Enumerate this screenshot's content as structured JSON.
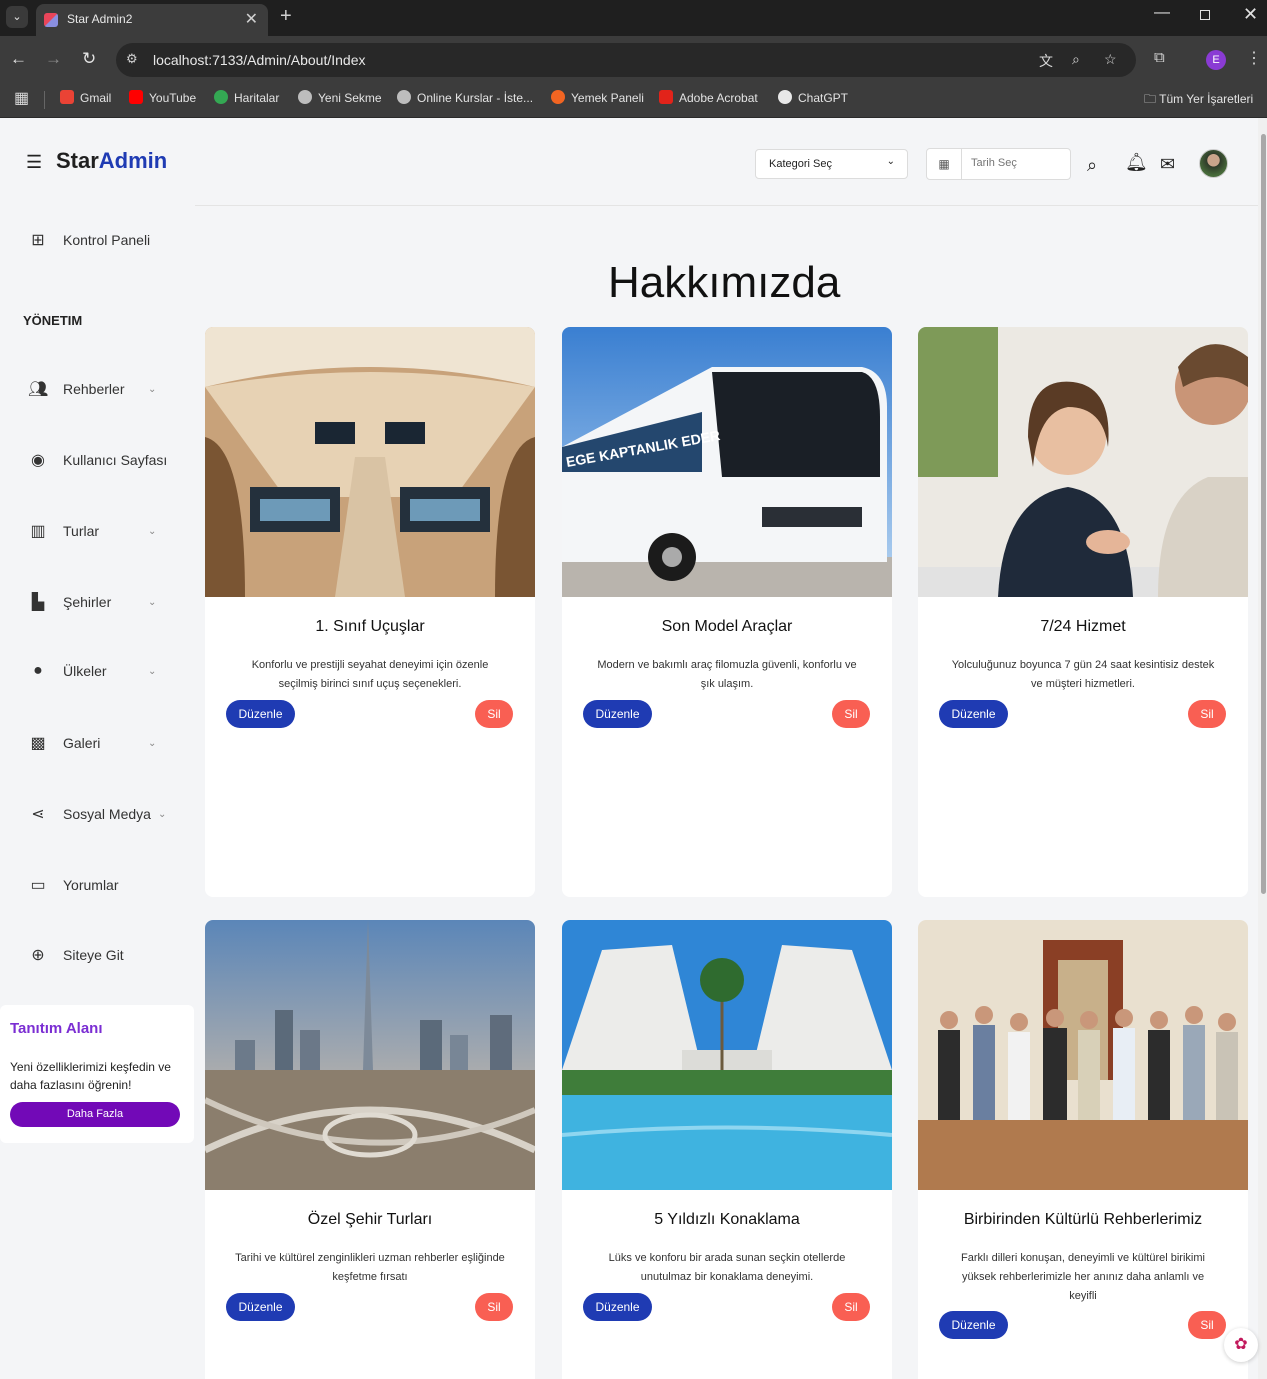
{
  "browser": {
    "tab_title": "Star Admin2",
    "url": "localhost:7133/Admin/About/Index",
    "profile_initial": "E",
    "bookmarks": [
      "Gmail",
      "YouTube",
      "Haritalar",
      "Yeni Sekme",
      "Online Kurslar - İste...",
      "Yemek Paneli",
      "Adobe Acrobat",
      "ChatGPT"
    ],
    "all_bookmarks": "Tüm Yer İşaretleri"
  },
  "brand": {
    "part1": "Star",
    "part2": "Admin"
  },
  "header": {
    "category_select": "Kategori Seç",
    "date_placeholder": "Tarih Seç"
  },
  "sidebar": {
    "dashboard": "Kontrol Paneli",
    "heading": "YÖNETIM",
    "items": [
      {
        "label": "Rehberler",
        "icon": "users-icon",
        "has_chevron": true
      },
      {
        "label": "Kullanıcı Sayfası",
        "icon": "user-circle-icon",
        "has_chevron": false
      },
      {
        "label": "Turlar",
        "icon": "map-icon",
        "has_chevron": true
      },
      {
        "label": "Şehirler",
        "icon": "city-icon",
        "has_chevron": true
      },
      {
        "label": "Ülkeler",
        "icon": "globe-icon",
        "has_chevron": true
      },
      {
        "label": "Galeri",
        "icon": "image-icon",
        "has_chevron": true
      },
      {
        "label": "Sosyal Medya",
        "icon": "share-icon",
        "has_chevron": true
      },
      {
        "label": "Yorumlar",
        "icon": "comment-icon",
        "has_chevron": false
      },
      {
        "label": "Siteye Git",
        "icon": "web-icon",
        "has_chevron": false
      }
    ],
    "promo": {
      "title": "Tanıtım Alanı",
      "text": "Yeni özelliklerimizi keşfedin ve daha fazlasını öğrenin!",
      "button": "Daha Fazla"
    }
  },
  "main": {
    "title": "Hakkımızda",
    "edit_label": "Düzenle",
    "delete_label": "Sil",
    "cards": [
      {
        "title": "1. Sınıf Uçuşlar",
        "text": "Konforlu ve prestijli seyahat deneyimi için özenle seçilmiş birinci sınıf uçuş seçenekleri."
      },
      {
        "title": "Son Model Araçlar",
        "text": "Modern ve bakımlı araç filomuzla güvenli, konforlu ve şık ulaşım."
      },
      {
        "title": "7/24 Hizmet",
        "text": "Yolculuğunuz boyunca 7 gün 24 saat kesintisiz destek ve müşteri hizmetleri."
      },
      {
        "title": "Özel Şehir Turları",
        "text": "Tarihi ve kültürel zenginlikleri uzman rehberler eşliğinde keşfetme fırsatı"
      },
      {
        "title": "5 Yıldızlı Konaklama",
        "text": "Lüks ve konforu bir arada sunan seçkin otellerde unutulmaz bir konaklama deneyimi."
      },
      {
        "title": "Birbirinden Kültürlü Rehberlerimiz",
        "text": "Farklı dilleri konuşan, deneyimli ve kültürel birikimi yüksek rehberlerimizle her anınız daha anlamlı ve keyifli"
      }
    ]
  },
  "colors": {
    "accent": "#1f3bb3",
    "danger": "#f95f53",
    "promo": "#7209b7"
  }
}
